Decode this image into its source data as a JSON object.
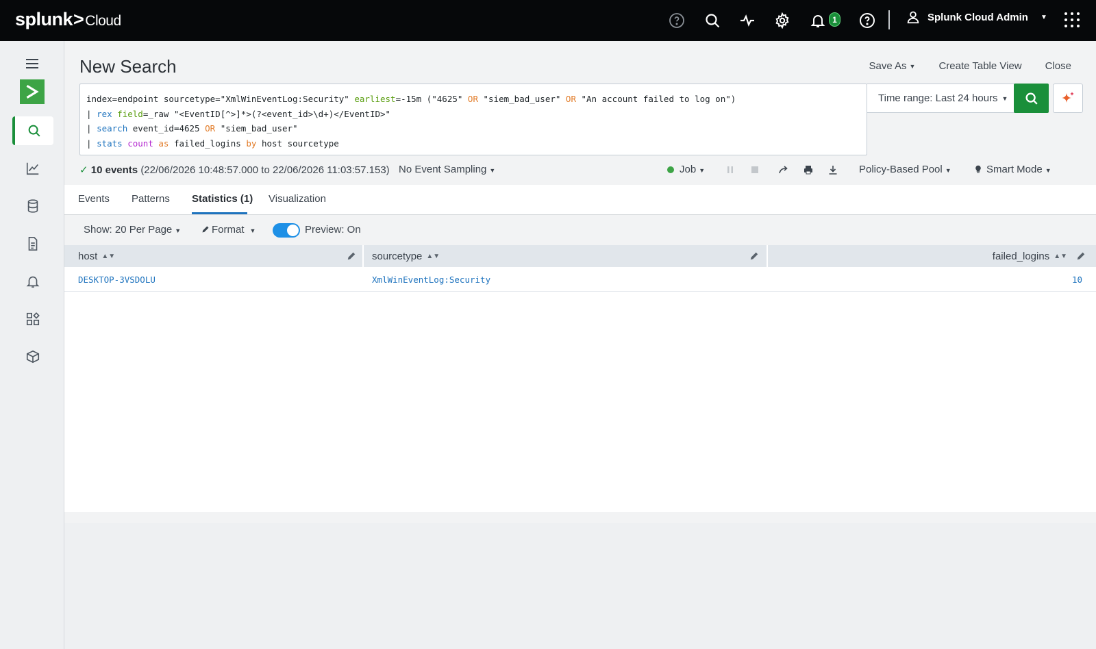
{
  "topbar": {
    "logo_brand": "splunk",
    "logo_sep": ">",
    "logo_product": "Cloud",
    "notification_count": "1",
    "user_name": "Splunk Cloud Admin",
    "icons": [
      "help-circle-icon",
      "search-icon",
      "activity-icon",
      "gear-icon",
      "bell-icon",
      "question-icon",
      "user-icon",
      "apps-grid-icon"
    ]
  },
  "sidebar": {
    "items": [
      "menu-icon",
      "app-icon",
      "search-icon",
      "chart-icon",
      "database-icon",
      "document-icon",
      "bell-icon",
      "dashboard-icon",
      "package-icon"
    ],
    "active": "search"
  },
  "page": {
    "title": "New Search",
    "actions": {
      "save_as": "Save As",
      "create_table_view": "Create Table View",
      "close": "Close"
    }
  },
  "query": {
    "line1_a": "index=endpoint sourcetype=\"XmlWinEventLog:Security\" ",
    "line1_b": "earliest",
    "line1_c": "=-15m (\"4625\" ",
    "line1_d": "OR",
    "line1_e": " \"siem_bad_user\" ",
    "line1_f": "OR",
    "line1_g": " \"An account failed to log on\")",
    "line2_a": "| ",
    "line2_b": "rex",
    "line2_c": " ",
    "line2_d": "field",
    "line2_e": "=_raw \"<EventID[^>]*>(?<event_id>\\d+)</EventID>\"",
    "line3_a": "| ",
    "line3_b": "search",
    "line3_c": " event_id=4625 ",
    "line3_d": "OR",
    "line3_e": " \"siem_bad_user\"",
    "line4_a": "| ",
    "line4_b": "stats",
    "line4_c": " ",
    "line4_d": "count",
    "line4_e": " ",
    "line4_f": "as",
    "line4_g": " failed_logins ",
    "line4_h": "by",
    "line4_i": " host sourcetype"
  },
  "time_range": "Time range: Last 24 hours",
  "status": {
    "check": "✓",
    "event_count": "10 events",
    "range": "(22/06/2026 10:48:57.000 to 22/06/2026 11:03:57.153)",
    "sampling": "No Event Sampling",
    "job": "Job",
    "pool": "Policy-Based Pool",
    "mode": "Smart Mode"
  },
  "tabs": [
    {
      "label": "Events"
    },
    {
      "label": "Patterns"
    },
    {
      "label": "Statistics (1)"
    },
    {
      "label": "Visualization"
    }
  ],
  "toolbar": {
    "show": "Show: 20 Per Page",
    "format": "Format",
    "preview": "Preview: On"
  },
  "table": {
    "columns": [
      "host",
      "sourcetype",
      "failed_logins"
    ],
    "rows": [
      [
        "DESKTOP-3VSDOLU",
        "XmlWinEventLog:Security",
        "10"
      ]
    ]
  }
}
